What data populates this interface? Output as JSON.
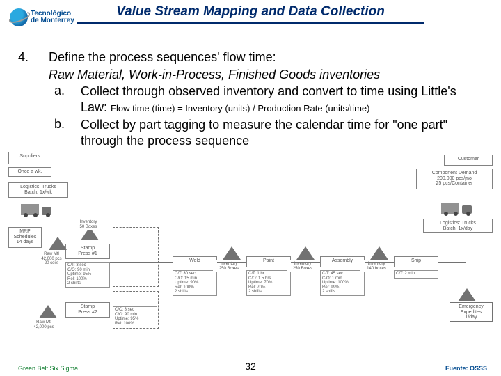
{
  "logo": {
    "line1": "Tecnológico",
    "line2": "de Monterrey"
  },
  "title": "Value Stream Mapping and Data Collection",
  "list": {
    "number": "4.",
    "heading": "Define the process sequences' flow time:",
    "subtitle": "Raw Material, Work-in-Process, Finished Goods inventories",
    "a_label": "a.",
    "a_text_pre": "Collect  through observed inventory and convert to time using Little's Law: ",
    "a_law": "Flow time (time) = Inventory (units) / Production Rate (units/time)",
    "b_label": "b.",
    "b_text": "Collect by part tagging to measure the calendar time for \"one part\" through the process sequence"
  },
  "diagram": {
    "suppliers": "Suppliers",
    "supplier_ship": "Once a wk.",
    "logistics_in": "Logistics: Trucks\nBatch: 1x/wk",
    "mrp": "MRP\nSchedules\n14 days",
    "stamp": "Stamp\nPress #1",
    "stamp2": "Stamp\nPress #2",
    "weld": "Weld",
    "paint": "Paint",
    "assembly": "Assembly",
    "ship": "Ship",
    "customer": "Customer",
    "customer_detail": "Component Demand\n200,000 pcs/mo\n25 pcs/Container",
    "logistics_out": "Logistics: Trucks\nBatch: 1x/day",
    "emergency": "Emergency\nExpedites\n1/day",
    "stamp_data": "C/T: 3 sec\nC/O: 90 min\nUptime: 95%\nRel: 100%\n2 shifts",
    "stamp_data2": "C/C: 3 sec\nC/O: 90 min\nUptime: 95%\nRel: 100%",
    "weld_data": "C/T: 30 sec\nC/O: 15 min\nUptime: 90%\nRel: 100%\n2 shifts",
    "paint_data": "C/T: 1 hr\nC/O: 1.5 hrs\nUptime: 70%\nRel: 70%\n2 shifts",
    "assy_data": "C/T: 45 sec\nC/O: 1 min\nUptime: 100%\nRel: 99%\n2 shifts",
    "ship_data": "C/T: 2 min",
    "raw1": "Raw Mtl\n42,000 pcs\n20 coils",
    "raw2": "Raw Mtl\n42,000 pcs",
    "inv1": "Inventory\n50 Boxes",
    "wip1": "Inventory\n250 Boxes",
    "wip2": "Inventory\n250 Boxes",
    "fg": "Inventory\n140 boxes"
  },
  "footer": {
    "left": "Green Belt Six Sigma",
    "center": "32",
    "right": "Fuente: OSSS"
  }
}
